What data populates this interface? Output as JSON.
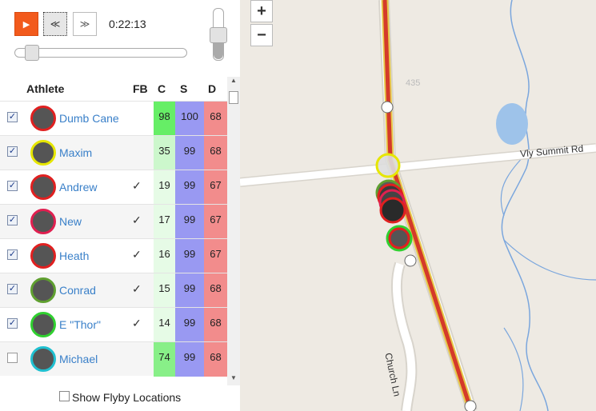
{
  "player": {
    "play_icon": "▶",
    "rewind_icon": "≪",
    "forward_icon": "≫",
    "time": "0:22:13",
    "scrub_position": 0.06,
    "speed_level": 0.55
  },
  "table": {
    "headers": {
      "athlete": "Athlete",
      "fb": "FB",
      "c": "C",
      "s": "S",
      "d": "D"
    },
    "rows": [
      {
        "checked": true,
        "name": "Dumb Cane",
        "fb": "",
        "c": "98",
        "s": "100",
        "d": "68",
        "ring": "#e02020",
        "cColor": "#66ee66"
      },
      {
        "checked": true,
        "name": "Maxim",
        "fb": "",
        "c": "35",
        "s": "99",
        "d": "68",
        "ring": "#e6e600",
        "cColor": "#ccf7cc"
      },
      {
        "checked": true,
        "name": "Andrew",
        "fb": "✓",
        "c": "19",
        "s": "99",
        "d": "67",
        "ring": "#e02020",
        "cColor": "#e6fbe6"
      },
      {
        "checked": true,
        "name": "New",
        "fb": "✓",
        "c": "17",
        "s": "99",
        "d": "67",
        "ring": "#e02050",
        "cColor": "#e6fbe6"
      },
      {
        "checked": true,
        "name": "Heath",
        "fb": "✓",
        "c": "16",
        "s": "99",
        "d": "67",
        "ring": "#e02020",
        "cColor": "#e6fbe6"
      },
      {
        "checked": true,
        "name": "Conrad",
        "fb": "✓",
        "c": "15",
        "s": "99",
        "d": "68",
        "ring": "#60a030",
        "cColor": "#e6fbe6"
      },
      {
        "checked": true,
        "name": "E \"Thor\"",
        "fb": "✓",
        "c": "14",
        "s": "99",
        "d": "68",
        "ring": "#30d030",
        "cColor": "#e6fbe6"
      },
      {
        "checked": false,
        "name": "Michael",
        "fb": "",
        "c": "74",
        "s": "99",
        "d": "68",
        "ring": "#20c0d0",
        "cColor": "#88ef88"
      }
    ]
  },
  "footer": {
    "flyby_label": "Show Flyby Locations"
  },
  "map": {
    "zoom_in": "+",
    "zoom_out": "−",
    "road_label_1": "Vly Summit Rd",
    "road_label_2": "Church Ln",
    "route_shield": "④"
  },
  "colors": {
    "accent": "#f25a1c",
    "link": "#3a80c9",
    "speed_col": "#9999f2",
    "dist_col": "#f28c8c"
  }
}
